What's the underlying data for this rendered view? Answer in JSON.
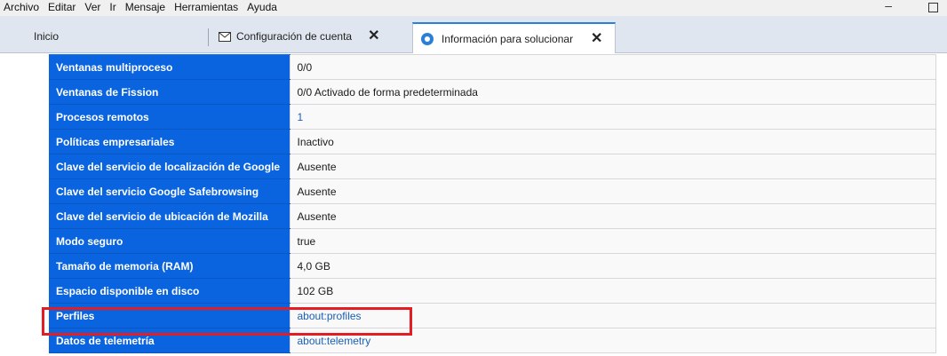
{
  "menubar": {
    "items": [
      "Archivo",
      "Editar",
      "Ver",
      "Ir",
      "Mensaje",
      "Herramientas",
      "Ayuda"
    ],
    "minimize": "–"
  },
  "tabs": {
    "home": "Inicio",
    "account": "Configuración de cuenta",
    "info": "Información para solucionar",
    "close": "✕"
  },
  "rows": [
    {
      "key": "Ventanas multiproceso",
      "value": "0/0"
    },
    {
      "key": "Ventanas de Fission",
      "value": "0/0 Activado de forma predeterminada"
    },
    {
      "key": "Procesos remotos",
      "value": "1"
    },
    {
      "key": "Políticas empresariales",
      "value": "Inactivo"
    },
    {
      "key": "Clave del servicio de localización de Google",
      "value": "Ausente"
    },
    {
      "key": "Clave del servicio Google Safebrowsing",
      "value": "Ausente"
    },
    {
      "key": "Clave del servicio de ubicación de Mozilla",
      "value": "Ausente"
    },
    {
      "key": "Modo seguro",
      "value": "true"
    },
    {
      "key": "Tamaño de memoria (RAM)",
      "value": "4,0 GB"
    },
    {
      "key": "Espacio disponible en disco",
      "value": "102 GB"
    },
    {
      "key": "Perfiles",
      "value": "about:profiles"
    },
    {
      "key": "Datos de telemetría",
      "value": "about:telemetry"
    }
  ],
  "colors": {
    "key_bg": "#0a64e0",
    "highlight": "#e21d24",
    "link": "#1a5fb4"
  }
}
